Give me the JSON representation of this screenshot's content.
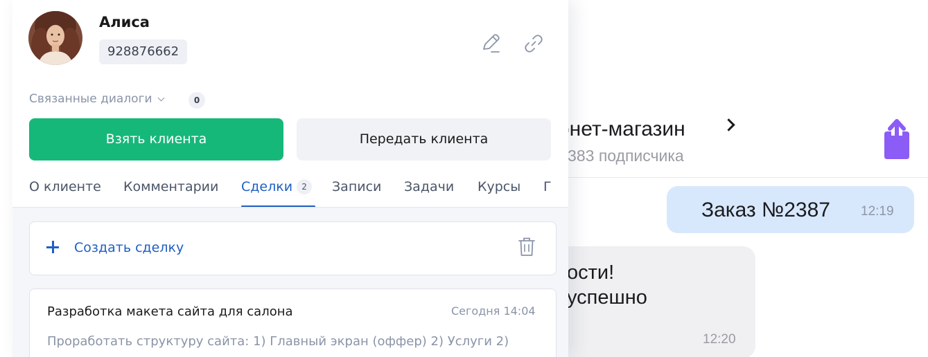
{
  "chat": {
    "title": "рнет-магазин",
    "subtitle": ") 383 подписчика",
    "outgoing_message": {
      "text": "Заказ №2387",
      "time": "12:19"
    },
    "incoming_message": {
      "line1": "ости!",
      "line2": "успешно",
      "time": "12:20"
    }
  },
  "client": {
    "name": "Алиса",
    "id": "928876662"
  },
  "related": {
    "label": "Связанные диалоги",
    "count": "0"
  },
  "buttons": {
    "take": "Взять клиента",
    "transfer": "Передать клиента"
  },
  "tabs": [
    {
      "label": "О клиенте"
    },
    {
      "label": "Комментарии"
    },
    {
      "label": "Сделки",
      "badge": "2",
      "active": true
    },
    {
      "label": "Записи"
    },
    {
      "label": "Задачи"
    },
    {
      "label": "Курсы"
    },
    {
      "label": "Г"
    }
  ],
  "create_deal": {
    "label": "Создать сделку"
  },
  "deal": {
    "title": "Разработка макета сайта для салона",
    "time": "Сегодня 14:04",
    "description": "Проработать структуру сайта: 1) Главный экран (оффер) 2) Услуги 2)"
  },
  "colors": {
    "accent": "#1f5fc4",
    "take_button": "#16b87a",
    "share_icon": "#8b5cf6",
    "outgoing_bubble": "#d8e8fc"
  },
  "icons": [
    "pencil-icon",
    "link-icon",
    "chevron-down-icon",
    "plus-icon",
    "trash-icon",
    "share-icon",
    "chevron-right-icon"
  ]
}
